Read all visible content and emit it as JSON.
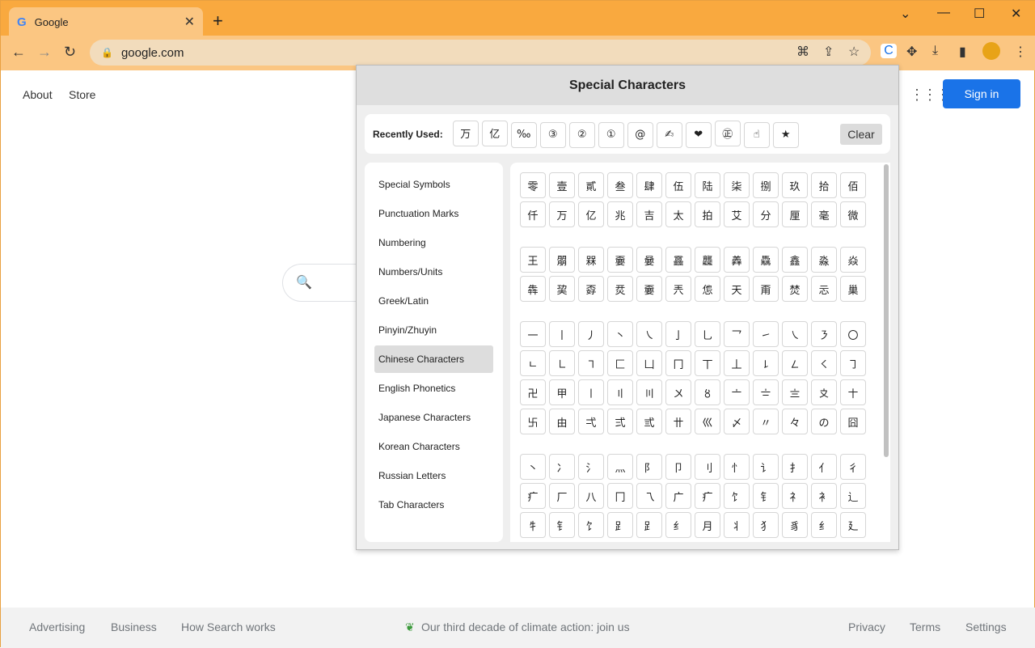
{
  "browser": {
    "tab_title": "Google",
    "url": "google.com"
  },
  "page": {
    "links": [
      "About",
      "Store"
    ],
    "sign_in": "Sign in",
    "footer_left": [
      "Advertising",
      "Business",
      "How Search works"
    ],
    "footer_center": "Our third decade of climate action: join us",
    "footer_right": [
      "Privacy",
      "Terms",
      "Settings"
    ]
  },
  "popup": {
    "title": "Special Characters",
    "recent_label": "Recently Used:",
    "recent": [
      "万",
      "亿",
      "‰",
      "③",
      "②",
      "①",
      "@",
      "✍",
      "❤",
      "㊣",
      "☝",
      "★"
    ],
    "clear": "Clear",
    "menu": [
      "Special Symbols",
      "Punctuation Marks",
      "Numbering",
      "Numbers/Units",
      "Greek/Latin",
      "Pinyin/Zhuyin",
      "Chinese Characters",
      "English Phonetics",
      "Japanese Characters",
      "Korean Characters",
      "Russian Letters",
      "Tab Characters"
    ],
    "active_menu": "Chinese Characters",
    "groups": [
      [
        "零",
        "壹",
        "貳",
        "叁",
        "肆",
        "伍",
        "陆",
        "柒",
        "捌",
        "玖",
        "拾",
        "佰",
        "仟",
        "万",
        "亿",
        "兆",
        "吉",
        "太",
        "拍",
        "艾",
        "分",
        "厘",
        "毫",
        "微"
      ],
      [
        "王",
        "朤",
        "槑",
        "嫑",
        "嘦",
        "靐",
        "龘",
        "羴",
        "驫",
        "鑫",
        "淼",
        "焱",
        "犇",
        "巭",
        "孬",
        "烎",
        "嫑",
        "兲",
        "怹",
        "天",
        "甭",
        "焚",
        "忈",
        "巢"
      ],
      [
        "一",
        "丨",
        "丿",
        "丶",
        "㇏",
        "亅",
        "乚",
        "乛",
        "㇀",
        "㇏",
        "㇋",
        "〇",
        "ㄴ",
        "㇗",
        "㇕",
        "匚",
        "凵",
        "冂",
        "丅",
        "丄",
        "㇙",
        "㇜",
        "㇛",
        "㇆",
        "卍",
        "甲",
        "〡",
        "〢",
        "〣",
        "〤",
        "〥",
        "〦",
        "〧",
        "〨",
        "〩",
        "〸",
        "卐",
        "由",
        "弌",
        "弍",
        "弎",
        "〹",
        "巛",
        "〆",
        "〃",
        "々",
        "の",
        "囧"
      ],
      [
        "丶",
        "冫",
        "氵",
        "灬",
        "阝",
        "卩",
        "刂",
        "忄",
        "讠",
        "扌",
        "亻",
        "彳",
        "疒",
        "厂",
        "八",
        "冂",
        "乁",
        "广",
        "疒",
        "饣",
        "钅",
        "礻",
        "衤",
        "辶",
        "牜",
        "钅",
        "饣",
        "𧾷",
        "⻊",
        "纟",
        "月",
        "丬",
        "犭",
        "豸",
        "纟",
        "廴"
      ]
    ]
  }
}
